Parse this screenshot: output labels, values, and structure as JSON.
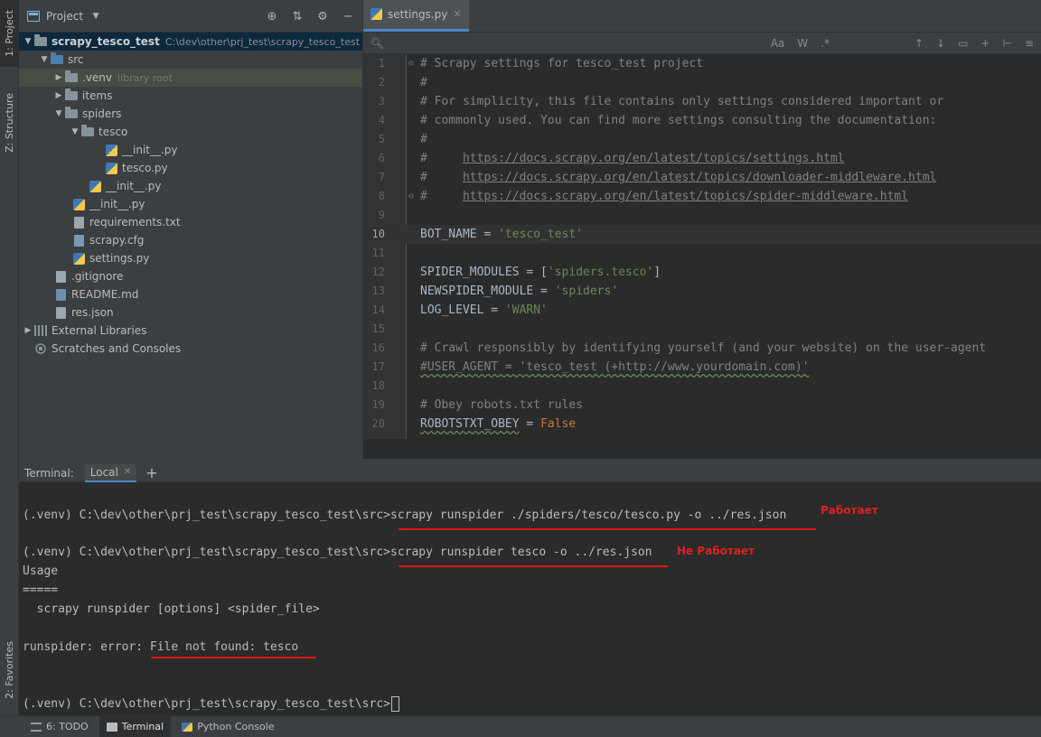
{
  "left_strip": {
    "project_tab": "1: Project",
    "structure_tab": "Z: Structure",
    "favorites_tab": "2: Favorites"
  },
  "project_panel": {
    "title": "Project",
    "tree": [
      {
        "label": "scrapy_tesco_test",
        "path": "C:\\dev\\other\\prj_test\\scrapy_tesco_test"
      },
      {
        "label": "src"
      },
      {
        "label": ".venv",
        "sub": "library root"
      },
      {
        "label": "items"
      },
      {
        "label": "spiders"
      },
      {
        "label": "tesco"
      },
      {
        "label": "__init__.py"
      },
      {
        "label": "tesco.py"
      },
      {
        "label": "__init__.py"
      },
      {
        "label": "__init__.py"
      },
      {
        "label": "requirements.txt"
      },
      {
        "label": "scrapy.cfg"
      },
      {
        "label": "settings.py"
      },
      {
        "label": ".gitignore"
      },
      {
        "label": "README.md"
      },
      {
        "label": "res.json"
      },
      {
        "label": "External Libraries"
      },
      {
        "label": "Scratches and Consoles"
      }
    ]
  },
  "editor": {
    "tab_label": "settings.py",
    "toolbar": {
      "match_case": "Aa",
      "words": "W",
      "regex": ".*"
    },
    "lines": [
      {
        "n": "1",
        "t": "# Scrapy settings for tesco_test project"
      },
      {
        "n": "2",
        "t": "#"
      },
      {
        "n": "3",
        "t": "# For simplicity, this file contains only settings considered important or"
      },
      {
        "n": "4",
        "t": "# commonly used. You can find more settings consulting the documentation:"
      },
      {
        "n": "5",
        "t": "#"
      },
      {
        "n": "6",
        "p": "#     ",
        "link": "https://docs.scrapy.org/en/latest/topics/settings.html"
      },
      {
        "n": "7",
        "p": "#     ",
        "link": "https://docs.scrapy.org/en/latest/topics/downloader-middleware.html"
      },
      {
        "n": "8",
        "p": "#     ",
        "link": "https://docs.scrapy.org/en/latest/topics/spider-middleware.html"
      },
      {
        "n": "9",
        "t": ""
      },
      {
        "n": "10",
        "id": "BOT_NAME = ",
        "str": "'tesco_test'"
      },
      {
        "n": "11",
        "t": ""
      },
      {
        "n": "12",
        "id": "SPIDER_MODULES = [",
        "str": "'spiders.tesco'",
        "tail": "]"
      },
      {
        "n": "13",
        "id": "NEWSPIDER_MODULE = ",
        "str": "'spiders'"
      },
      {
        "n": "14",
        "id": "LOG_LEVEL = ",
        "str": "'WARN'"
      },
      {
        "n": "15",
        "t": ""
      },
      {
        "n": "16",
        "t": "# Crawl responsibly by identifying yourself (and your website) on the user-agent"
      },
      {
        "n": "17",
        "t": "#USER_AGENT = 'tesco_test (+http://www.yourdomain.com)'"
      },
      {
        "n": "18",
        "t": ""
      },
      {
        "n": "19",
        "t": "# Obey robots.txt rules"
      },
      {
        "n": "20",
        "id": "ROBOTSTXT_OBEY",
        "mid": " = ",
        "kw": "False"
      }
    ]
  },
  "terminal": {
    "label": "Terminal:",
    "tab": "Local",
    "prompt": "(.venv) C:\\dev\\other\\prj_test\\scrapy_tesco_test\\src>",
    "cmd1": "scrapy runspider ./spiders/tesco/tesco.py -o ../res.json",
    "annot1": "Работает",
    "cmd2": "scrapy runspider tesco -o ../res.json",
    "annot2": "Не Работает",
    "usage": "Usage",
    "sep": "=====",
    "usage_line": "  scrapy runspider [options] <spider_file>",
    "error_prefix": "runspider: error: ",
    "error_msg": "File not found: tesco"
  },
  "bottom_bar": {
    "todo": "6: TODO",
    "terminal": "Terminal",
    "python_console": "Python Console"
  },
  "colors": {
    "selection": "#0d293e",
    "annotation": "#e02020",
    "string": "#6a8759",
    "keyword": "#cc7832",
    "comment": "#808080"
  }
}
